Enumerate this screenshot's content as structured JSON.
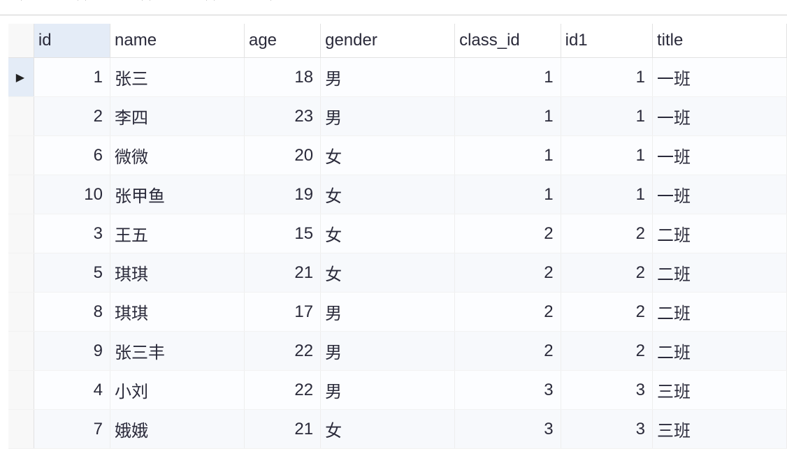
{
  "tabs": [
    {
      "label": "信息"
    },
    {
      "label": "结果"
    },
    {
      "label": "概况"
    },
    {
      "label": "状态"
    }
  ],
  "columns": [
    {
      "key": "id",
      "label": "id",
      "align": "num",
      "active_sort": true
    },
    {
      "key": "name",
      "label": "name",
      "align": "text"
    },
    {
      "key": "age",
      "label": "age",
      "align": "num"
    },
    {
      "key": "gender",
      "label": "gender",
      "align": "text"
    },
    {
      "key": "class_id",
      "label": "class_id",
      "align": "num"
    },
    {
      "key": "id1",
      "label": "id1",
      "align": "num"
    },
    {
      "key": "title",
      "label": "title",
      "align": "text"
    }
  ],
  "rows": [
    {
      "id": 1,
      "name": "张三",
      "age": 18,
      "gender": "男",
      "class_id": 1,
      "id1": 1,
      "title": "一班",
      "current": true
    },
    {
      "id": 2,
      "name": "李四",
      "age": 23,
      "gender": "男",
      "class_id": 1,
      "id1": 1,
      "title": "一班"
    },
    {
      "id": 6,
      "name": "微微",
      "age": 20,
      "gender": "女",
      "class_id": 1,
      "id1": 1,
      "title": "一班"
    },
    {
      "id": 10,
      "name": "张甲鱼",
      "age": 19,
      "gender": "女",
      "class_id": 1,
      "id1": 1,
      "title": "一班"
    },
    {
      "id": 3,
      "name": "王五",
      "age": 15,
      "gender": "女",
      "class_id": 2,
      "id1": 2,
      "title": "二班"
    },
    {
      "id": 5,
      "name": "琪琪",
      "age": 21,
      "gender": "女",
      "class_id": 2,
      "id1": 2,
      "title": "二班"
    },
    {
      "id": 8,
      "name": "琪琪",
      "age": 17,
      "gender": "男",
      "class_id": 2,
      "id1": 2,
      "title": "二班"
    },
    {
      "id": 9,
      "name": "张三丰",
      "age": 22,
      "gender": "男",
      "class_id": 2,
      "id1": 2,
      "title": "二班"
    },
    {
      "id": 4,
      "name": "小刘",
      "age": 22,
      "gender": "男",
      "class_id": 3,
      "id1": 3,
      "title": "三班"
    },
    {
      "id": 7,
      "name": "娥娥",
      "age": 21,
      "gender": "女",
      "class_id": 3,
      "id1": 3,
      "title": "三班"
    }
  ],
  "row_pointer_glyph": "▶"
}
